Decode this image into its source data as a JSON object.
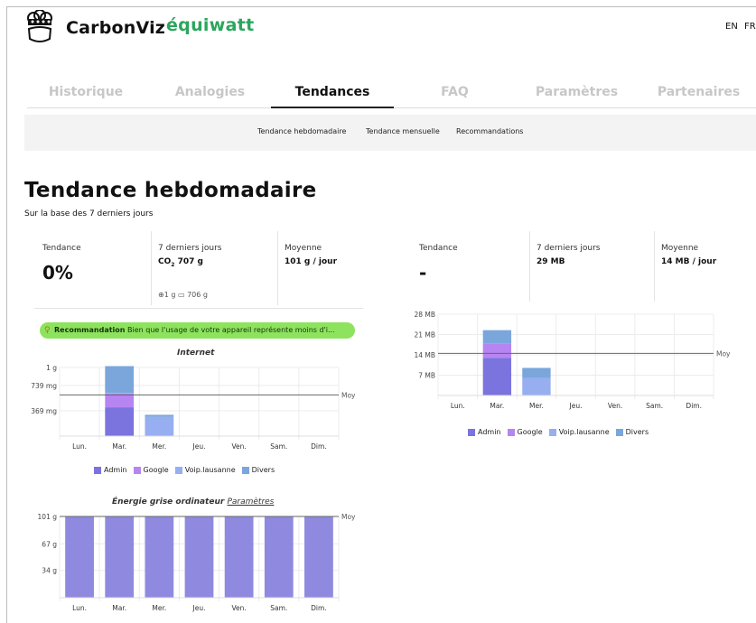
{
  "app": {
    "name": "CarbonViz",
    "partner": "équiwatt"
  },
  "languages": [
    "EN",
    "FR"
  ],
  "nav": {
    "tabs": [
      "Historique",
      "Analogies",
      "Tendances",
      "FAQ",
      "Paramètres",
      "Partenaires"
    ],
    "active": "Tendances"
  },
  "subnav": [
    "Tendance hebdomadaire",
    "Tendance mensuelle",
    "Recommandations"
  ],
  "page": {
    "title": "Tendance hebdomadaire",
    "subtitle": "Sur la base des 7 derniers jours"
  },
  "co2_panel": {
    "trend_label": "Tendance",
    "trend_value": "0%",
    "last7_label": "7 derniers jours",
    "last7_prefix": "CO",
    "last7_sub": "2",
    "last7_value": "707 g",
    "avg_label": "Moyenne",
    "avg_value": "101 g / jour",
    "detail_internet": "1 g",
    "detail_computer": "706 g"
  },
  "data_panel": {
    "trend_label": "Tendance",
    "trend_value": "-",
    "last7_label": "7 derniers jours",
    "last7_value": "29 MB",
    "avg_label": "Moyenne",
    "avg_value": "14 MB / jour"
  },
  "recommendation": {
    "label": "Recommandation",
    "text": "Bien que l'usage de votre appareil représente moins d'i..."
  },
  "colors": {
    "admin": "#7b73de",
    "google": "#b785f2",
    "voip": "#97aef0",
    "divers": "#7aa6dc",
    "computer": "#8f8ae0",
    "reco_bg": "#8ee35e"
  },
  "legend": [
    "Admin",
    "Google",
    "Voip.lausanne",
    "Divers"
  ],
  "chart_data": [
    {
      "type": "bar",
      "title": "Internet",
      "categories": [
        "Lun.",
        "Mar.",
        "Mer.",
        "Jeu.",
        "Ven.",
        "Sam.",
        "Dim."
      ],
      "series": [
        {
          "name": "Admin",
          "values": [
            0,
            0.42,
            0,
            0,
            0,
            0,
            0
          ]
        },
        {
          "name": "Google",
          "values": [
            0,
            0.2,
            0,
            0,
            0,
            0,
            0
          ]
        },
        {
          "name": "Voip.lausanne",
          "values": [
            0,
            0.01,
            0.28,
            0,
            0,
            0,
            0
          ]
        },
        {
          "name": "Divers",
          "values": [
            0,
            0.39,
            0.03,
            0,
            0,
            0,
            0
          ]
        }
      ],
      "yticks": [
        {
          "value": 1,
          "label": "1 g"
        },
        {
          "value": 0.739,
          "label": "739 mg"
        },
        {
          "value": 0.369,
          "label": "369 mg"
        }
      ],
      "ylim": [
        0,
        1
      ],
      "average": {
        "value": 0.6,
        "label": "Moy"
      }
    },
    {
      "type": "bar",
      "title": "Énergie grise ordinateur",
      "title_link": "Paramètres",
      "categories": [
        "Lun.",
        "Mar.",
        "Mer.",
        "Jeu.",
        "Ven.",
        "Sam.",
        "Dim."
      ],
      "series": [
        {
          "values": [
            101,
            101,
            101,
            101,
            101,
            101,
            101
          ]
        }
      ],
      "yticks": [
        {
          "value": 101,
          "label": "101 g"
        },
        {
          "value": 67,
          "label": "67 g"
        },
        {
          "value": 34,
          "label": "34 g"
        }
      ],
      "ylim": [
        0,
        101
      ],
      "average": {
        "value": 101,
        "label": "Moy"
      }
    },
    {
      "type": "bar",
      "title": "",
      "categories": [
        "Lun.",
        "Mar.",
        "Mer.",
        "Jeu.",
        "Ven.",
        "Sam.",
        "Dim."
      ],
      "series": [
        {
          "name": "Admin",
          "values": [
            0,
            13,
            0,
            0,
            0,
            0,
            0
          ]
        },
        {
          "name": "Google",
          "values": [
            0,
            5,
            0,
            0,
            0,
            0,
            0
          ]
        },
        {
          "name": "Voip.lausanne",
          "values": [
            0,
            0,
            6,
            0,
            0,
            0,
            0
          ]
        },
        {
          "name": "Divers",
          "values": [
            0,
            4.5,
            3.5,
            0,
            0,
            0,
            0
          ]
        }
      ],
      "yticks": [
        {
          "value": 28,
          "label": "28 MB"
        },
        {
          "value": 21,
          "label": "21 MB"
        },
        {
          "value": 14,
          "label": "14 MB"
        },
        {
          "value": 7,
          "label": "7 MB"
        }
      ],
      "ylim": [
        0,
        28
      ],
      "average": {
        "value": 14.5,
        "label": "Moy"
      }
    }
  ]
}
